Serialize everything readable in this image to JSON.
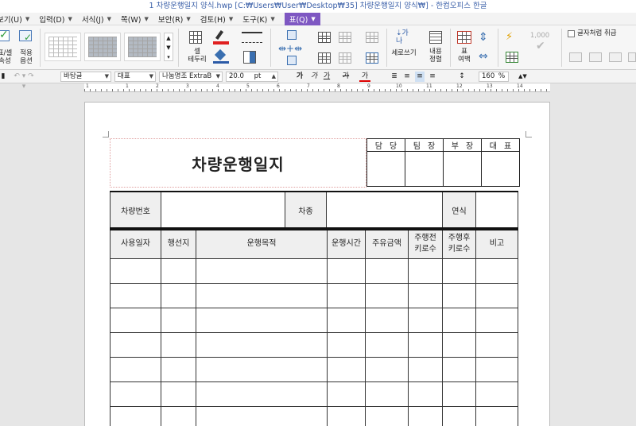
{
  "window": {
    "title": "1 차량운행일지 양식.hwp [C:₩Users₩User₩Desktop₩35] 차량운행일지 양식₩] - 한컴오피스 한글"
  },
  "menu": {
    "items": [
      {
        "label": "보기(U)"
      },
      {
        "label": "입력(D)"
      },
      {
        "label": "서식(J)"
      },
      {
        "label": "쪽(W)"
      },
      {
        "label": "보안(R)"
      },
      {
        "label": "검토(H)"
      },
      {
        "label": "도구(K)"
      },
      {
        "label": "표(Q)"
      }
    ]
  },
  "ribbon": {
    "cell_attr_label": "표/셀\n속성",
    "apply_option_label": "적용\n옵션",
    "cell_border_label": "셀\n테두리",
    "vertical_write_label": "세로쓰기",
    "content_align_label": "내용\n정렬",
    "table_margin_label": "표\n여백",
    "treat_as_char_label": "글자처럼 취급",
    "number_value": "1,000"
  },
  "format": {
    "style": "바탕글",
    "lang": "대표",
    "font": "나눔명조 ExtraB",
    "size": "20.0",
    "unit": "pt",
    "bold": "가",
    "italic": "가",
    "underline": "가",
    "strike": "가",
    "color": "가",
    "zoom": "160",
    "zoom_unit": "%"
  },
  "ruler": {
    "numbers": [
      "1",
      "1",
      "2",
      "3",
      "4",
      "5",
      "6",
      "7",
      "8",
      "9",
      "10",
      "11",
      "12",
      "13",
      "14"
    ]
  },
  "document": {
    "title": "차량운행일지",
    "approval": [
      "담당",
      "팀장",
      "부장",
      "대표"
    ],
    "info": {
      "vehicle_no": "차량번호",
      "model": "차종",
      "year": "연식"
    },
    "log_headers": [
      "사용일자",
      "행선지",
      "운행목적",
      "운행시간",
      "주유금액",
      "주행전\n키로수",
      "주행후\n키로수",
      "비고"
    ],
    "log_rows": 7
  }
}
